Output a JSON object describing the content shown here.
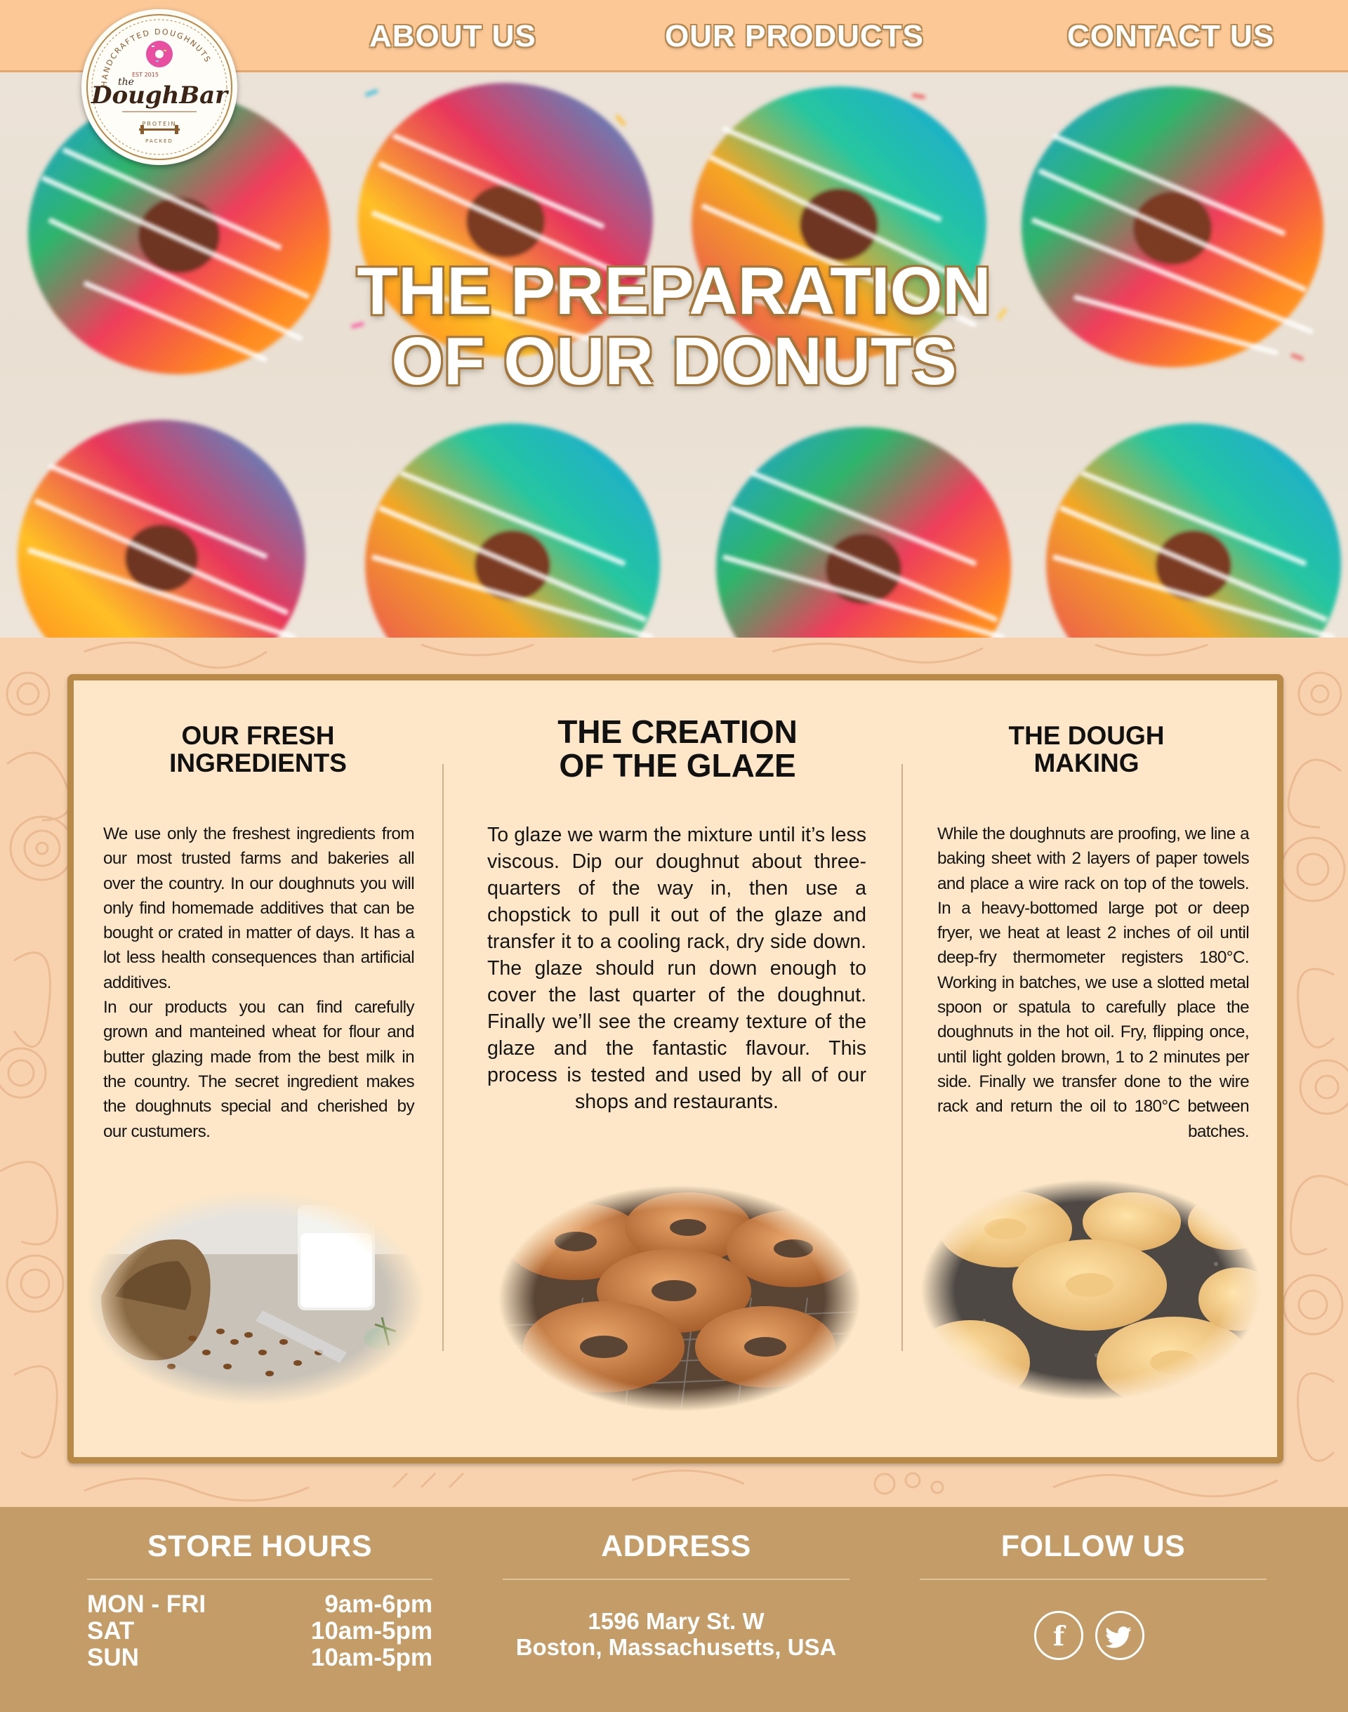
{
  "logo": {
    "ring_text": "HANDCRAFTED DOUGHNUTS",
    "est": "EST 2015",
    "the": "the",
    "brand": "DoughBar",
    "tagline_1": "PROTEIN",
    "tagline_2": "PACKED"
  },
  "nav": {
    "about": "ABOUT US",
    "products": "OUR PRODUCTS",
    "contact": "CONTACT US"
  },
  "hero": {
    "title_line1": "THE PREPARATION",
    "title_line2": "OF OUR DONUTS"
  },
  "columns": {
    "ingredients": {
      "title_line1": "OUR FRESH",
      "title_line2": "INGREDIENTS",
      "para1": "We use only the freshest ingredients from our most trusted farms and bakeries all over the country. In our doughnuts you will only find homemade additives that can be bought or crated in matter of days. It has a lot less health consequences than artificial additives.",
      "para2": "In our products you can find carefully grown and manteined wheat for flour and butter glazing made from the best milk in the country. The secret ingredient makes the doughnuts special and cherished by our custumers."
    },
    "glaze": {
      "title_line1": "THE CREATION",
      "title_line2": "OF THE GLAZE",
      "body": "To glaze we warm the mixture until it’s less viscous. Dip our doughnut about three-quarters of the way in, then use a chopstick to pull it out of the glaze and transfer it to a cooling rack, dry side down. The glaze should run down enough to cover the last quarter of the doughnut. Finally we’ll see the creamy texture of the glaze and the fantastic flavour. This process is tested and used by all of our shops and restaurants."
    },
    "dough": {
      "title_line1": "THE DOUGH",
      "title_line2": "MAKING",
      "body": "While the doughnuts are proofing, we line a baking sheet with 2 layers of paper towels and place a wire rack on top of the towels. In a heavy-bottomed large pot or deep fryer, we heat at least 2 inches of oil until deep-fry thermometer registers 180°C. Working in batches, we use a slotted metal spoon or spatula to carefully place the doughnuts in the hot oil. Fry, flipping once, until light golden brown, 1 to 2 minutes per side. Finally we transfer done to the wire rack and return the oil to 180°C between batches."
    }
  },
  "footer": {
    "hours_title": "STORE HOURS",
    "hours": [
      {
        "day": "MON - FRI",
        "time": "9am-6pm"
      },
      {
        "day": "SAT",
        "time": "10am-5pm"
      },
      {
        "day": "SUN",
        "time": "10am-5pm"
      }
    ],
    "address_title": "ADDRESS",
    "address_line1": "1596 Mary St. W",
    "address_line2": "Boston, Massachusetts, USA",
    "follow_title": "FOLLOW US",
    "social": {
      "facebook": "f"
    }
  },
  "colors": {
    "header_bg": "#fbc896",
    "panel_bg": "#fde7c8",
    "panel_border": "#b98a47",
    "footer_bg": "#c39c68",
    "pattern_bg": "#f8d2ae"
  },
  "icons": [
    "facebook-icon",
    "twitter-icon",
    "barbell-icon",
    "donut-icon"
  ]
}
